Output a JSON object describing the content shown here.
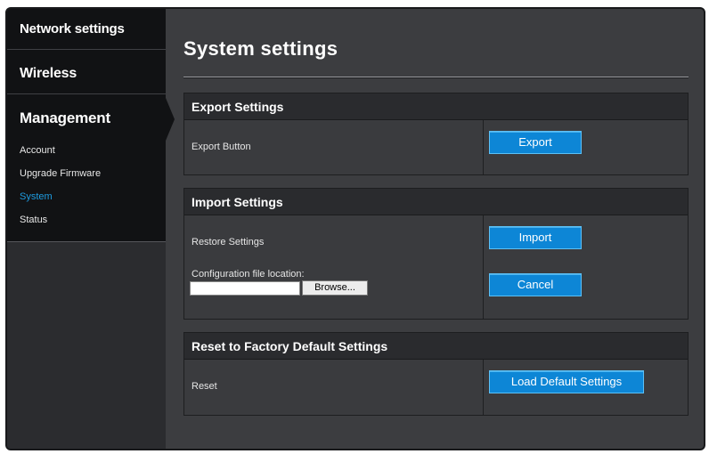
{
  "sidebar": {
    "sections": {
      "network": "Network settings",
      "wireless": "Wireless",
      "management": "Management"
    },
    "submenu": [
      "Account",
      "Upgrade Firmware",
      "System",
      "Status"
    ],
    "active_item": "System"
  },
  "main": {
    "title": "System settings",
    "export": {
      "header": "Export Settings",
      "label": "Export Button",
      "button": "Export"
    },
    "import": {
      "header": "Import Settings",
      "restore_label": "Restore Settings",
      "file_label": "Configuration file location:",
      "browse_button": "Browse...",
      "import_button": "Import",
      "cancel_button": "Cancel",
      "file_value": ""
    },
    "reset": {
      "header": "Reset to Factory Default Settings",
      "label": "Reset",
      "button": "Load Default Settings"
    }
  },
  "colors": {
    "accent": "#0d86d6",
    "active_link": "#1e9be0",
    "background": "#3c3d40"
  }
}
